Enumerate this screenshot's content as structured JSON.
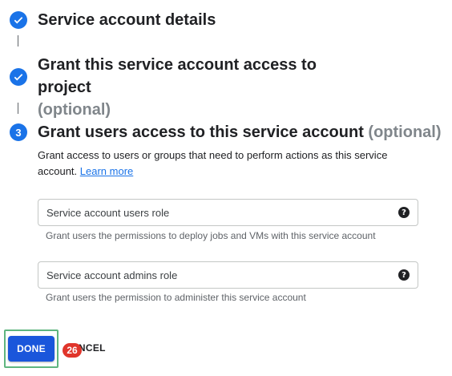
{
  "colors": {
    "accent": "#1a73e8",
    "done_button": "#1a56db",
    "badge": "#e0352b",
    "highlight": "#5fb57f"
  },
  "steps": [
    {
      "icon": "check-icon",
      "title": "Service account details",
      "optional": ""
    },
    {
      "icon": "check-icon",
      "title": "Grant this service account access to project",
      "optional": "(optional)"
    },
    {
      "icon": "step-number",
      "number": "3",
      "title": "Grant users access to this service account",
      "optional": "(optional)"
    }
  ],
  "description": {
    "text": "Grant access to users or groups that need to perform actions as this service account.",
    "link": "Learn more"
  },
  "fields": [
    {
      "label": "Service account users role",
      "hint": "Grant users the permissions to deploy jobs and VMs with this service account"
    },
    {
      "label": "Service account admins role",
      "hint": "Grant users the permission to administer this service account"
    }
  ],
  "actions": {
    "done_label": "DONE",
    "cancel_label": "CANCEL",
    "badge": "26"
  }
}
